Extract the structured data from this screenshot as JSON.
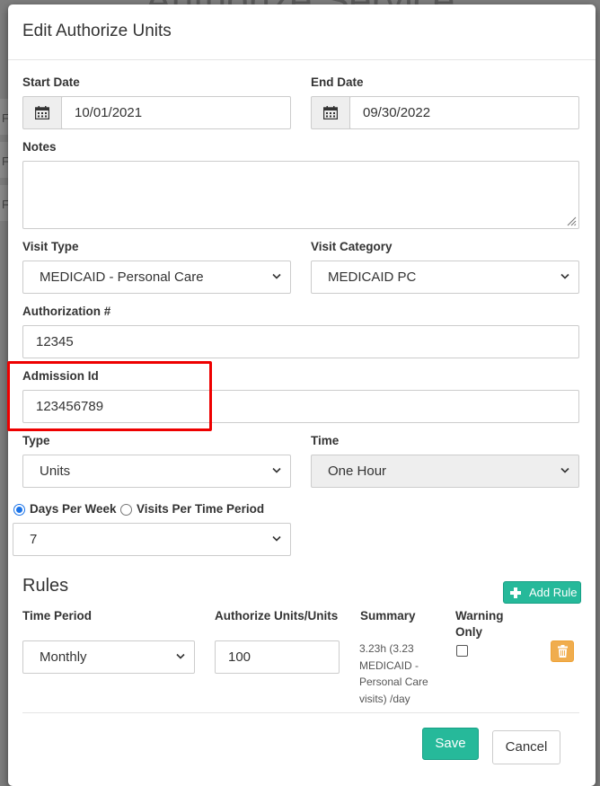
{
  "background": {
    "page_title": "Authorize Service",
    "row_chars": [
      "F",
      "F",
      "F"
    ]
  },
  "modal": {
    "title": "Edit Authorize Units",
    "start_date": {
      "label": "Start Date",
      "value": "10/01/2021",
      "icon": "calendar-icon"
    },
    "end_date": {
      "label": "End Date",
      "value": "09/30/2022",
      "icon": "calendar-icon"
    },
    "notes": {
      "label": "Notes",
      "value": ""
    },
    "visit_type": {
      "label": "Visit Type",
      "selected": "MEDICAID - Personal Care"
    },
    "visit_category": {
      "label": "Visit Category",
      "selected": "MEDICAID PC"
    },
    "authorization": {
      "label": "Authorization #",
      "value": "12345"
    },
    "admission_id": {
      "label": "Admission Id",
      "value": "123456789"
    },
    "type": {
      "label": "Type",
      "selected": "Units"
    },
    "time": {
      "label": "Time",
      "selected": "One Hour",
      "disabled": true
    },
    "frequency": {
      "option_days": "Days Per Week",
      "option_visits": "Visits Per Time Period",
      "selected_option": "Days Per Week",
      "value": "7"
    },
    "rules": {
      "title": "Rules",
      "add_rule_label": "Add Rule",
      "columns": {
        "time_period": "Time Period",
        "authorize_units": "Authorize Units/Units",
        "summary": "Summary",
        "warning_line1": "Warning",
        "warning_line2": "Only"
      },
      "rows": [
        {
          "time_period": "Monthly",
          "units": "100",
          "summary_lines": [
            "3.23h (3.23",
            "MEDICAID -",
            "Personal Care",
            "visits) /day"
          ],
          "warning_only": false
        }
      ]
    },
    "footer": {
      "save_label": "Save",
      "cancel_label": "Cancel"
    }
  },
  "colors": {
    "primary": "#26b99a",
    "warning": "#f0ad4e",
    "highlight": "#e00000",
    "radio_accent": "#1a73e8"
  }
}
